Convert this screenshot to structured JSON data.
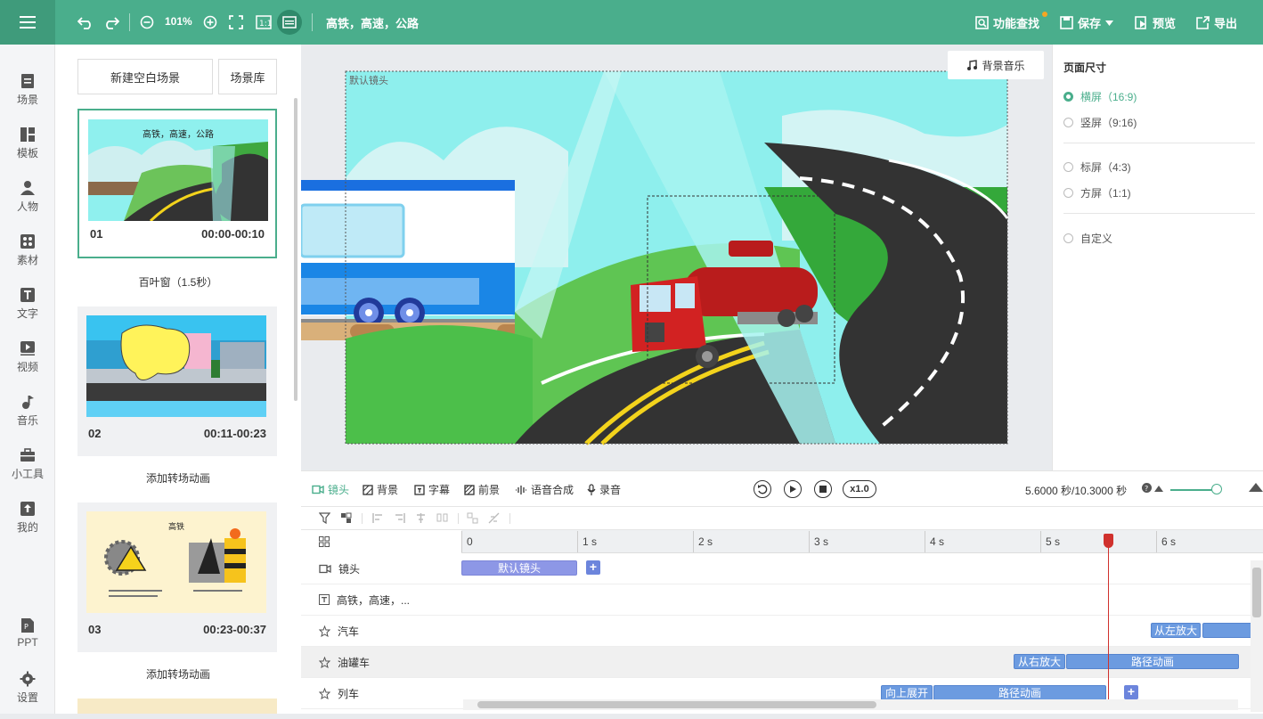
{
  "toolbar": {
    "zoom": "101%",
    "scene_title": "高铁，高速，公路",
    "feature_search": "功能查找",
    "save": "保存",
    "preview": "预览",
    "export": "导出"
  },
  "leftnav": [
    {
      "label": "场景",
      "icon": "scene-icon"
    },
    {
      "label": "模板",
      "icon": "template-icon"
    },
    {
      "label": "人物",
      "icon": "person-icon"
    },
    {
      "label": "素材",
      "icon": "material-icon"
    },
    {
      "label": "文字",
      "icon": "text-icon"
    },
    {
      "label": "视频",
      "icon": "video-icon"
    },
    {
      "label": "音乐",
      "icon": "music-icon"
    },
    {
      "label": "小工具",
      "icon": "toolbox-icon"
    },
    {
      "label": "我的",
      "icon": "upload-icon"
    },
    {
      "label": "PPT",
      "icon": "ppt-icon"
    },
    {
      "label": "设置",
      "icon": "settings-icon"
    }
  ],
  "scenes_panel": {
    "new_blank": "新建空白场景",
    "library": "场景库",
    "scenes": [
      {
        "num": "01",
        "time": "00:00-00:10",
        "thumb_title": "高铁，高速，公路",
        "transition": "百叶窗（1.5秒）"
      },
      {
        "num": "02",
        "time": "00:11-00:23",
        "thumb_title": "",
        "transition": "添加转场动画"
      },
      {
        "num": "03",
        "time": "00:23-00:37",
        "thumb_title": "高铁",
        "transition": "添加转场动画"
      }
    ]
  },
  "canvas": {
    "camera_label": "默认镜头",
    "bgm_button": "背景音乐"
  },
  "right_panel": {
    "title": "页面尺寸",
    "options": [
      {
        "label": "横屏（16:9)",
        "selected": true
      },
      {
        "label": "竖屏（9:16)",
        "selected": false
      },
      {
        "label": "标屏（4:3)",
        "selected": false
      },
      {
        "label": "方屏（1:1)",
        "selected": false
      },
      {
        "label": "自定义",
        "selected": false
      }
    ]
  },
  "timeline": {
    "tabs": [
      "镜头",
      "背景",
      "字幕",
      "前景",
      "语音合成",
      "录音"
    ],
    "speed": "x1.0",
    "time_readout": "5.6000 秒/10.3000 秒",
    "ruler": [
      "0",
      "1 s",
      "2 s",
      "3 s",
      "4 s",
      "5 s",
      "6 s"
    ],
    "tracks": [
      {
        "name": "镜头",
        "icon": "camera-icon",
        "clips": [
          "默认镜头"
        ]
      },
      {
        "name": "高铁，高速，...",
        "icon": "text-icon",
        "clips": []
      },
      {
        "name": "汽车",
        "icon": "star-icon",
        "clips": [
          "从左放大",
          ""
        ]
      },
      {
        "name": "油罐车",
        "icon": "star-icon",
        "clips": [
          "从右放大",
          "路径动画"
        ]
      },
      {
        "name": "列车",
        "icon": "star-icon",
        "clips": [
          "向上展开",
          "路径动画"
        ]
      }
    ]
  },
  "colors": {
    "brand": "#4aae8c",
    "clip": "#6c9be0",
    "playhead": "#d0312d"
  }
}
